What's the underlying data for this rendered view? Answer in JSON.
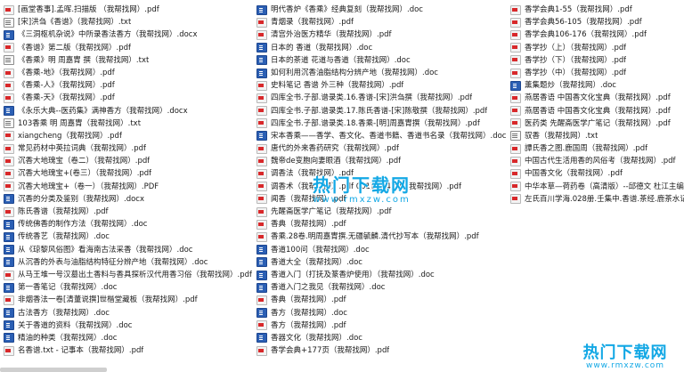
{
  "columns": [
    [
      {
        "name": "[画堂香事].孟晖.扫描版 （我帮找网）.pdf",
        "icon": "pdf"
      },
      {
        "name": "[宋]洪刍《香谱》（我帮找网）.txt",
        "icon": "txt"
      },
      {
        "name": "《三洞枢机杂说》中所录香法香方（我帮找网）.docx",
        "icon": "doc"
      },
      {
        "name": "《香谱》第二版（我帮找网）.pdf",
        "icon": "pdf"
      },
      {
        "name": "《香乘》明 周嘉胄 撰（我帮找网）.txt",
        "icon": "txt"
      },
      {
        "name": "《香乘-地》（我帮找网）.pdf",
        "icon": "pdf"
      },
      {
        "name": "《香乘-人》（我帮找网）.pdf",
        "icon": "pdf"
      },
      {
        "name": "《香乘-天》（我帮找网）.pdf",
        "icon": "pdf"
      },
      {
        "name": "《永乐大典--医药集》满神香方（我帮找网）.docx",
        "icon": "doc"
      },
      {
        "name": "103香乘 明 周嘉胄（我帮找网）.txt",
        "icon": "txt"
      },
      {
        "name": "xiangcheng（我帮找网）.pdf",
        "icon": "pdf"
      },
      {
        "name": "常见药材中英拉词典（我帮找网）.pdf",
        "icon": "pdf"
      },
      {
        "name": "沉香大地瑰宝（卷二）（我帮找网）.pdf",
        "icon": "pdf"
      },
      {
        "name": "沉香大地瑰宝+(卷三）（我帮找网）.pdf",
        "icon": "pdf"
      },
      {
        "name": "沉香大地瑰宝+（卷一）（我帮找网）.PDF",
        "icon": "pdf"
      },
      {
        "name": "沉香的分类及鉴别（我帮找网）.docx",
        "icon": "doc"
      },
      {
        "name": "陈氏香谱（我帮找网）.pdf",
        "icon": "pdf"
      },
      {
        "name": "传统佛香的制作方法（我帮找网）.doc",
        "icon": "doc"
      },
      {
        "name": "传统香艺（我帮找网）.doc",
        "icon": "doc"
      },
      {
        "name": "从《琼黎风俗图》看海南古法采香（我帮找网）.doc",
        "icon": "doc"
      },
      {
        "name": "从沉香的外表与油脂结构特征分辨产地（我帮找网）.doc",
        "icon": "doc"
      },
      {
        "name": "从马王堆一号汉墓出土香料与香具探析汉代用香习俗（我帮找网）.pdf",
        "icon": "pdf"
      },
      {
        "name": "第一香笔记（我帮找网）.doc",
        "icon": "doc"
      },
      {
        "name": "非烟香法一卷[清董说撰]世楷堂藏板（我帮找网）.pdf",
        "icon": "pdf"
      },
      {
        "name": "古法香方（我帮找网）.doc",
        "icon": "doc"
      },
      {
        "name": "关于香道的资料（我帮找网）.doc",
        "icon": "doc"
      },
      {
        "name": "精油的种类（我帮找网）.doc",
        "icon": "doc"
      },
      {
        "name": "名香谱.txt - 记事本（我帮找网）.pdf",
        "icon": "pdf"
      }
    ],
    [
      {
        "name": "明代香炉《香乘》经典复刻（我帮找网）.doc",
        "icon": "doc"
      },
      {
        "name": "青烟录（我帮找网）.pdf",
        "icon": "pdf"
      },
      {
        "name": "清宫外治医方精华（我帮找网）.pdf",
        "icon": "pdf"
      },
      {
        "name": "日本的 香道（我帮找网）.doc",
        "icon": "doc"
      },
      {
        "name": "日本的茶道 花道与香道（我帮找网）.doc",
        "icon": "doc"
      },
      {
        "name": "如何利用沉香油脂结构分辨产地（我帮找网）.doc",
        "icon": "doc"
      },
      {
        "name": "史料笔记 香谱 外三种（我帮找网）.pdf",
        "icon": "pdf"
      },
      {
        "name": "四库全书.子部.谱录类.16.香谱-[宋]洪刍撰（我帮找网）.pdf",
        "icon": "pdf"
      },
      {
        "name": "四库全书.子部.谱录类.17.陈氏香谱-[宋]陈敬撰（我帮找网）.pdf",
        "icon": "pdf"
      },
      {
        "name": "四库全书.子部.谱录类.18.香乘-[明]周嘉胄撰（我帮找网）.pdf",
        "icon": "pdf"
      },
      {
        "name": "宋本香乘——香学、香文化、香道书籍、香道书名录（我帮找网）.doc",
        "icon": "doc"
      },
      {
        "name": "唐代的外来香药研究（我帮找网）.pdf",
        "icon": "pdf"
      },
      {
        "name": "魏帝de变胞向妻眼酒（我帮找网）.pdf",
        "icon": "pdf"
      },
      {
        "name": "调香法（我帮找网）.pdf",
        "icon": "pdf"
      },
      {
        "name": "调香术（我帮找网）.pdf                                001][384页]（我帮找网）.pdf",
        "icon": "pdf"
      },
      {
        "name": "闻香（我帮找网）.pdf",
        "icon": "pdf"
      },
      {
        "name": "先醒斋医学广笔记（我帮找网）.pdf",
        "icon": "pdf"
      },
      {
        "name": "香典（我帮找网）.pdf",
        "icon": "pdf"
      },
      {
        "name": "香乘.28卷.明周嘉胄撰.无疆毓麟.清代抄写本（我帮找网）.pdf",
        "icon": "pdf"
      },
      {
        "name": "香道100问（我帮找网）.doc",
        "icon": "doc"
      },
      {
        "name": "香道大全（我帮找网）.doc",
        "icon": "doc"
      },
      {
        "name": "香道入门（打抚及篆香炉使用）（我帮找网）.doc",
        "icon": "doc"
      },
      {
        "name": "香道入门之我见（我帮找网）.doc",
        "icon": "doc"
      },
      {
        "name": "香典（我帮找网）.pdf",
        "icon": "pdf"
      },
      {
        "name": "香方（我帮找网）.doc",
        "icon": "doc"
      },
      {
        "name": "香方（我帮找网）.pdf",
        "icon": "pdf"
      },
      {
        "name": "香器文化（我帮找网）.doc",
        "icon": "doc"
      },
      {
        "name": "香学会典+177页（我帮找网）.pdf",
        "icon": "pdf"
      }
    ],
    [
      {
        "name": "香学会典1-55（我帮找网）.pdf",
        "icon": "pdf"
      },
      {
        "name": "香学会典56-105（我帮找网）.pdf",
        "icon": "pdf"
      },
      {
        "name": "香学会典106-176（我帮找网）.pdf",
        "icon": "pdf"
      },
      {
        "name": "香学抄（上）（我帮找网）.pdf",
        "icon": "pdf"
      },
      {
        "name": "香学抄（下）（我帮找网）.pdf",
        "icon": "pdf"
      },
      {
        "name": "香学抄（中）（我帮找网）.pdf",
        "icon": "pdf"
      },
      {
        "name": "薰集题炒（我帮找网）.doc",
        "icon": "doc"
      },
      {
        "name": "燕居香语 中国香文化宝典（我帮找网）.pdf",
        "icon": "pdf"
      },
      {
        "name": "燕居香语 中国香文化宝典（我帮找网）.pdf",
        "icon": "pdf"
      },
      {
        "name": "医药类 先醒斋医学广笔记（我帮找网）.pdf",
        "icon": "pdf"
      },
      {
        "name": "驭香（我帮找网）.txt",
        "icon": "txt"
      },
      {
        "name": "譚氏香之图.鹿国周（我帮找网）.pdf",
        "icon": "pdf"
      },
      {
        "name": "中国古代生活用香的风俗考（我帮找网）.pdf",
        "icon": "pdf"
      },
      {
        "name": "中国香文化（我帮找网）.pdf",
        "icon": "pdf"
      },
      {
        "name": "中华本草—荷药卷（高清版）--邱德文 杜江主编（我帮找网）.pdf",
        "icon": "pdf"
      },
      {
        "name": "左氏百川学海.028册.壬集中.香谱.茶经.鹿茶水记.茶录（我帮找网）.pdf",
        "icon": "pdf"
      }
    ]
  ],
  "watermark_center": {
    "title": "热门下载网",
    "url": "www.rmxzw.com"
  },
  "watermark_corner": {
    "title": "热门下载网",
    "url": "www.rmxzw.com"
  }
}
